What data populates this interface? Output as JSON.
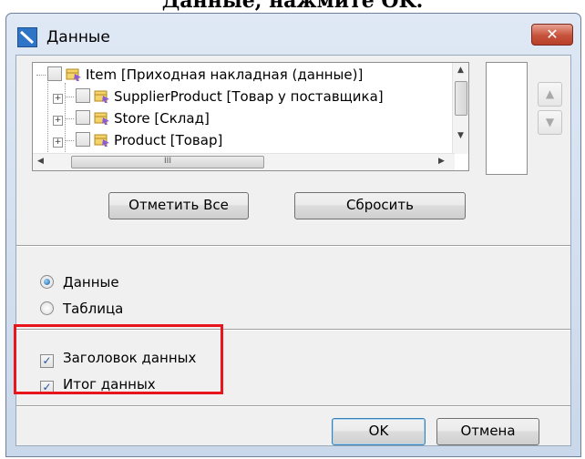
{
  "header_text": "Данные, нажмите OK.",
  "window": {
    "title": "Данные",
    "close_label": "✕"
  },
  "tree": {
    "items": [
      {
        "label": "Item [Приходная накладная (данные)]"
      },
      {
        "label": "SupplierProduct [Товар у поставщика]"
      },
      {
        "label": "Store [Склад]"
      },
      {
        "label": "Product [Товар]"
      }
    ],
    "hscroll_thumb_glyph": "III"
  },
  "buttons": {
    "check_all": "Отметить Все",
    "reset": "Сбросить",
    "ok": "OK",
    "cancel": "Отмена"
  },
  "radio": {
    "options": [
      {
        "label": "Данные",
        "selected": true
      },
      {
        "label": "Таблица",
        "selected": false
      }
    ]
  },
  "checks": {
    "items": [
      {
        "label": "Заголовок данных",
        "checked": true
      },
      {
        "label": "Итог данных",
        "checked": true
      }
    ]
  },
  "colors": {
    "highlight": "#e8161c",
    "title_bar": "#dfe8f4",
    "close_button": "#c7523b"
  }
}
